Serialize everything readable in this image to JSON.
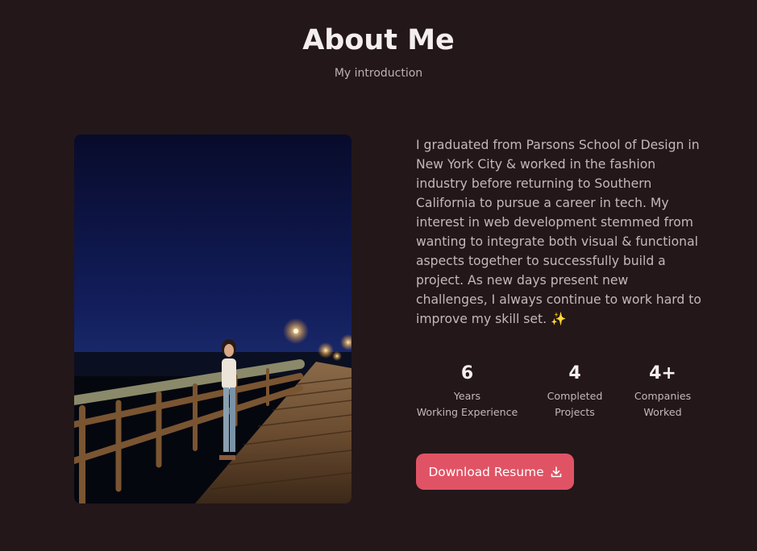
{
  "header": {
    "title": "About Me",
    "subtitle": "My introduction"
  },
  "about": {
    "bio": "I graduated from Parsons School of Design in New York City & worked in the fashion industry before returning to Southern California to pursue a career in tech. My interest in web development stemmed from wanting to integrate both visual & functional aspects together to successfully build a project. As new days present new challenges, I always continue to work hard to improve my skill set. ✨",
    "stats": [
      {
        "value": "6",
        "line1": "Years",
        "line2": "Working Experience"
      },
      {
        "value": "4",
        "line1": "Completed",
        "line2": "Projects"
      },
      {
        "value": "4+",
        "line1": "Companies",
        "line2": "Worked"
      }
    ],
    "button_label": "Download Resume",
    "button_icon": "download-icon"
  },
  "colors": {
    "background": "#231719",
    "accent": "#e05365"
  }
}
